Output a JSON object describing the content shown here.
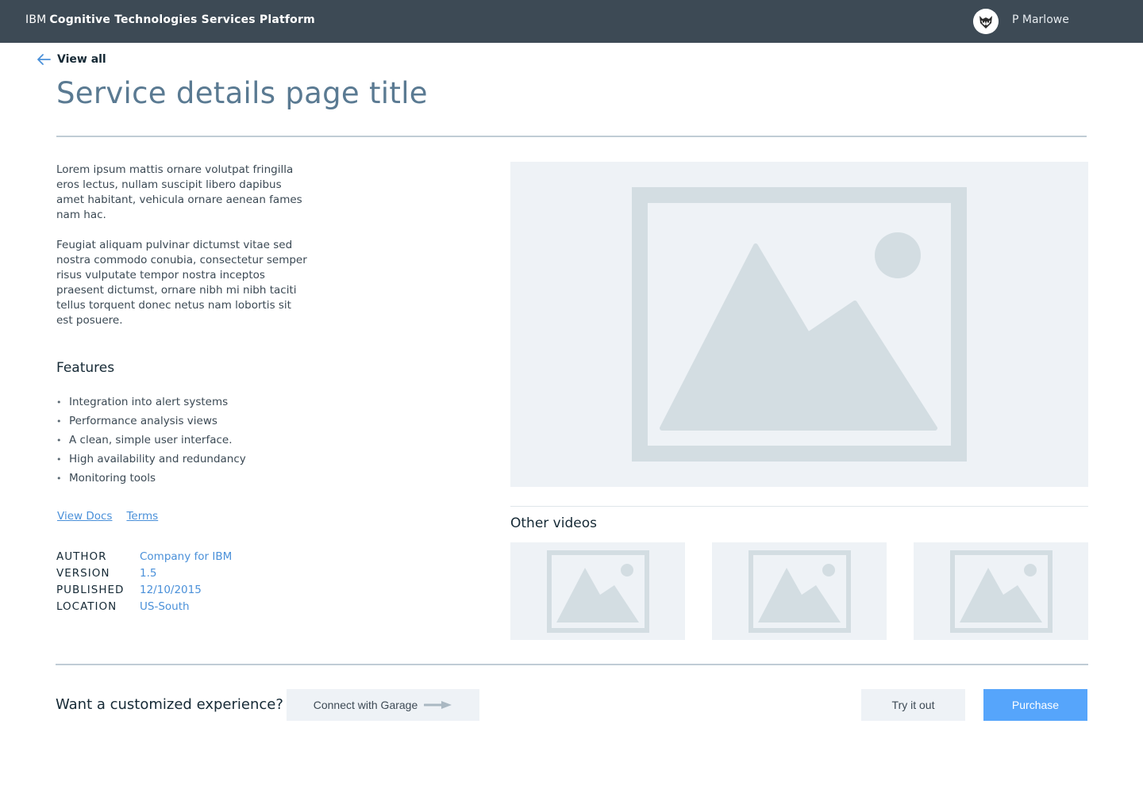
{
  "header": {
    "brand_prefix": "IBM",
    "brand_name": "Cognitive Technologies Services Platform",
    "user_name": "P Marlowe"
  },
  "nav": {
    "back_label": "View all"
  },
  "page": {
    "title": "Service details page title",
    "description": [
      "Lorem ipsum mattis ornare volutpat fringilla eros lectus, nullam suscipit libero dapibus amet habitant, vehicula ornare aenean fames nam hac.",
      "Feugiat aliquam pulvinar dictumst vitae sed nostra commodo conubia, consectetur semper risus vulputate tempor nostra inceptos praesent dictumst, ornare nibh mi nibh taciti tellus torquent donec netus nam lobortis sit est posuere."
    ]
  },
  "features": {
    "heading": "Features",
    "items": [
      "Integration into alert systems",
      "Performance analysis views",
      "A clean, simple user interface.",
      "High availability and redundancy",
      "Monitoring tools"
    ],
    "bullet": "•"
  },
  "links": {
    "docs": "View Docs",
    "terms": "Terms"
  },
  "meta": {
    "author_label": "AUTHOR",
    "author_value": "Company for IBM",
    "version_label": "VERSION",
    "version_value": "1.5",
    "published_label": "PUBLISHED",
    "published_value": "12/10/2015",
    "location_label": "LOCATION",
    "location_value": "US-South"
  },
  "media": {
    "hero_icon": "image-placeholder-icon",
    "other_videos_heading": "Other videos",
    "thumb_icon": "image-placeholder-icon"
  },
  "footer": {
    "cta_text": "Want a customized experience?",
    "connect_label": "Connect with Garage",
    "try_label": "Try it out",
    "purchase_label": "Purchase"
  },
  "colors": {
    "header_bg": "#3d4a55",
    "accent": "#56a5fb",
    "link": "#4a90d9",
    "placeholder_bg": "#eef2f6",
    "placeholder_fg": "#d3dde2"
  }
}
